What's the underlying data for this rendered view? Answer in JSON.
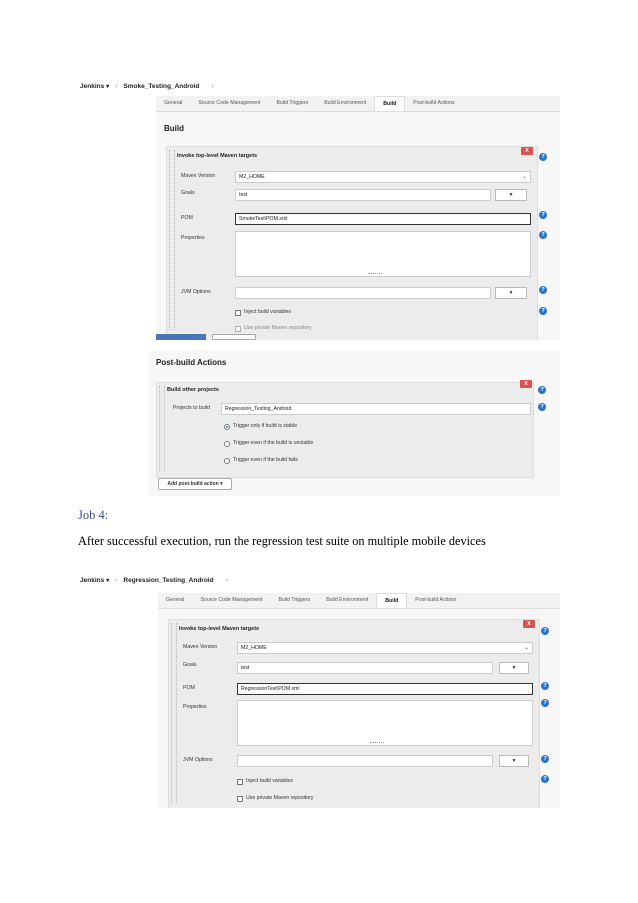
{
  "shot1": {
    "breadcrumb": {
      "root": "Jenkins",
      "root_caret": "▾",
      "sep": "›",
      "job": "Smoke_Testing_Android"
    },
    "tabs": [
      "General",
      "Source Code Management",
      "Build Triggers",
      "Build Environment",
      "Build",
      "Post-build Actions"
    ],
    "active_tab": "Build",
    "section_title": "Build",
    "step_title": "Invoke top-level Maven targets",
    "labels": {
      "maven_version": "Maven Version",
      "goals": "Goals",
      "pom": "POM",
      "properties": "Properties",
      "jvm_options": "JVM Options"
    },
    "values": {
      "maven_version": "M2_HOME",
      "goals": "test",
      "pom": "SmokeTest\\POM.xml",
      "properties": "",
      "jvm_options": ""
    },
    "checkboxes": {
      "inject": "Inject build variables",
      "private_repo": "Use private Maven repository"
    },
    "x_label": "X",
    "help_label": "?",
    "dd_label": "▼"
  },
  "shot2": {
    "section_title": "Post-build Actions",
    "step_title": "Build other projects",
    "labels": {
      "projects_to_build": "Projects to build"
    },
    "values": {
      "projects_to_build": "Regression_Testing_Android"
    },
    "radios": [
      "Trigger only if build is stable",
      "Trigger even if the build is unstable",
      "Trigger even if the build fails"
    ],
    "selected_radio": 0,
    "add_button": "Add post-build action ▾",
    "x_label": "X",
    "help_label": "?"
  },
  "doc": {
    "heading": "Job 4:",
    "paragraph": "After successful execution, run the regression test suite on multiple mobile devices"
  },
  "shot3": {
    "breadcrumb": {
      "root": "Jenkins",
      "root_caret": "▾",
      "sep": "›",
      "job": "Regression_Testing_Android"
    },
    "tabs": [
      "General",
      "Source Code Management",
      "Build Triggers",
      "Build Environment",
      "Build",
      "Post-build Actions"
    ],
    "active_tab": "Build",
    "step_title": "Invoke top-level Maven targets",
    "labels": {
      "maven_version": "Maven Version",
      "goals": "Goals",
      "pom": "POM",
      "properties": "Properties",
      "jvm_options": "JVM Options"
    },
    "values": {
      "maven_version": "M2_HOME",
      "goals": "test",
      "pom": "RegressionTest\\POM.xml",
      "properties": "",
      "jvm_options": ""
    },
    "checkboxes": {
      "inject": "Inject build variables",
      "private_repo": "Use private Maven repository"
    },
    "x_label": "X",
    "help_label": "?",
    "dd_label": "▼"
  }
}
